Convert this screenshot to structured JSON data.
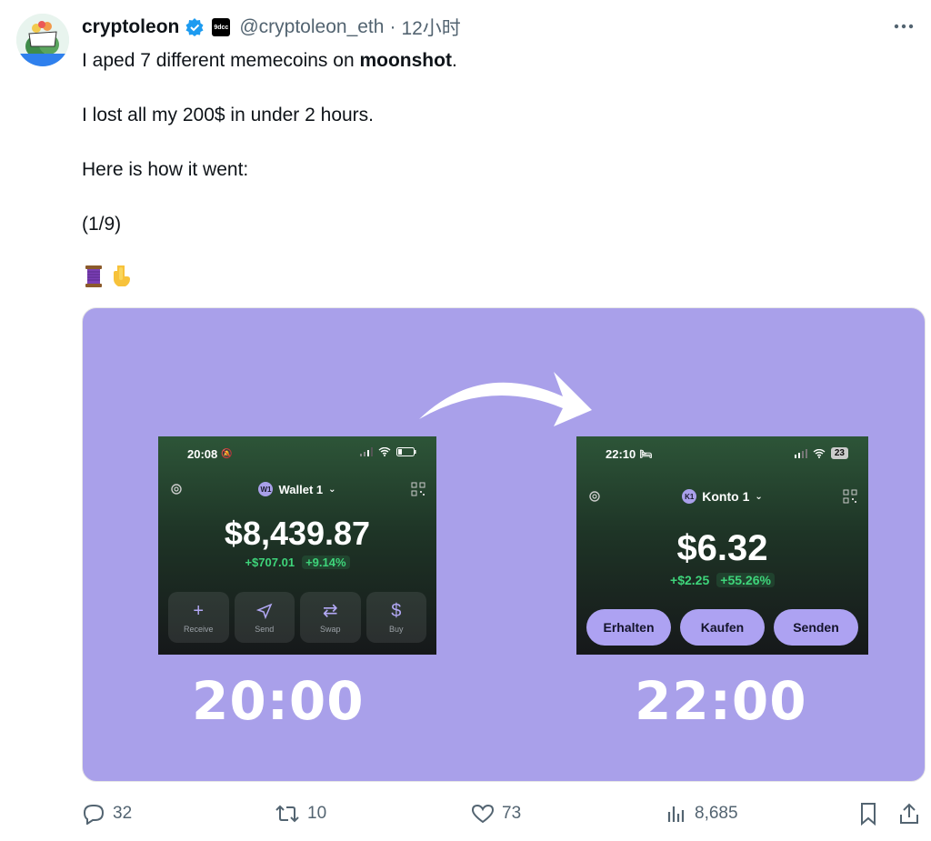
{
  "author": {
    "name": "cryptoleon",
    "affiliate_badge": "9dcc",
    "handle": "@cryptoleon_eth",
    "separator": "·",
    "time": "12小时"
  },
  "tweet": {
    "line1_pre": "I aped 7 different memecoins on ",
    "line1_bold": "moonshot",
    "line1_post": ".",
    "line2": "I lost all my 200$ in under 2 hours.",
    "line3": "Here is how it went:",
    "line4": "(1/9)",
    "emojis": [
      "thread-icon",
      "pointing-down-icon"
    ]
  },
  "media": {
    "background": "#a9a0ea",
    "before": {
      "status_time": "20:08",
      "account_badge": "W1",
      "account_name": "Wallet 1",
      "balance": "$8,439.87",
      "change_amount": "+$707.01",
      "change_percent": "+9.14%",
      "actions": [
        {
          "label": "Receive",
          "icon": "+"
        },
        {
          "label": "Send",
          "icon": "➤"
        },
        {
          "label": "Swap",
          "icon": "⇄"
        },
        {
          "label": "Buy",
          "icon": "$"
        }
      ],
      "clock_label": "20:00"
    },
    "after": {
      "status_time": "22:10",
      "battery": "23",
      "account_badge": "K1",
      "account_name": "Konto 1",
      "balance": "$6.32",
      "change_amount": "+$2.25",
      "change_percent": "+55.26%",
      "actions": [
        "Erhalten",
        "Kaufen",
        "Senden"
      ],
      "clock_label": "22:00"
    }
  },
  "footer": {
    "replies": "32",
    "reposts": "10",
    "likes": "73",
    "views": "8,685"
  }
}
